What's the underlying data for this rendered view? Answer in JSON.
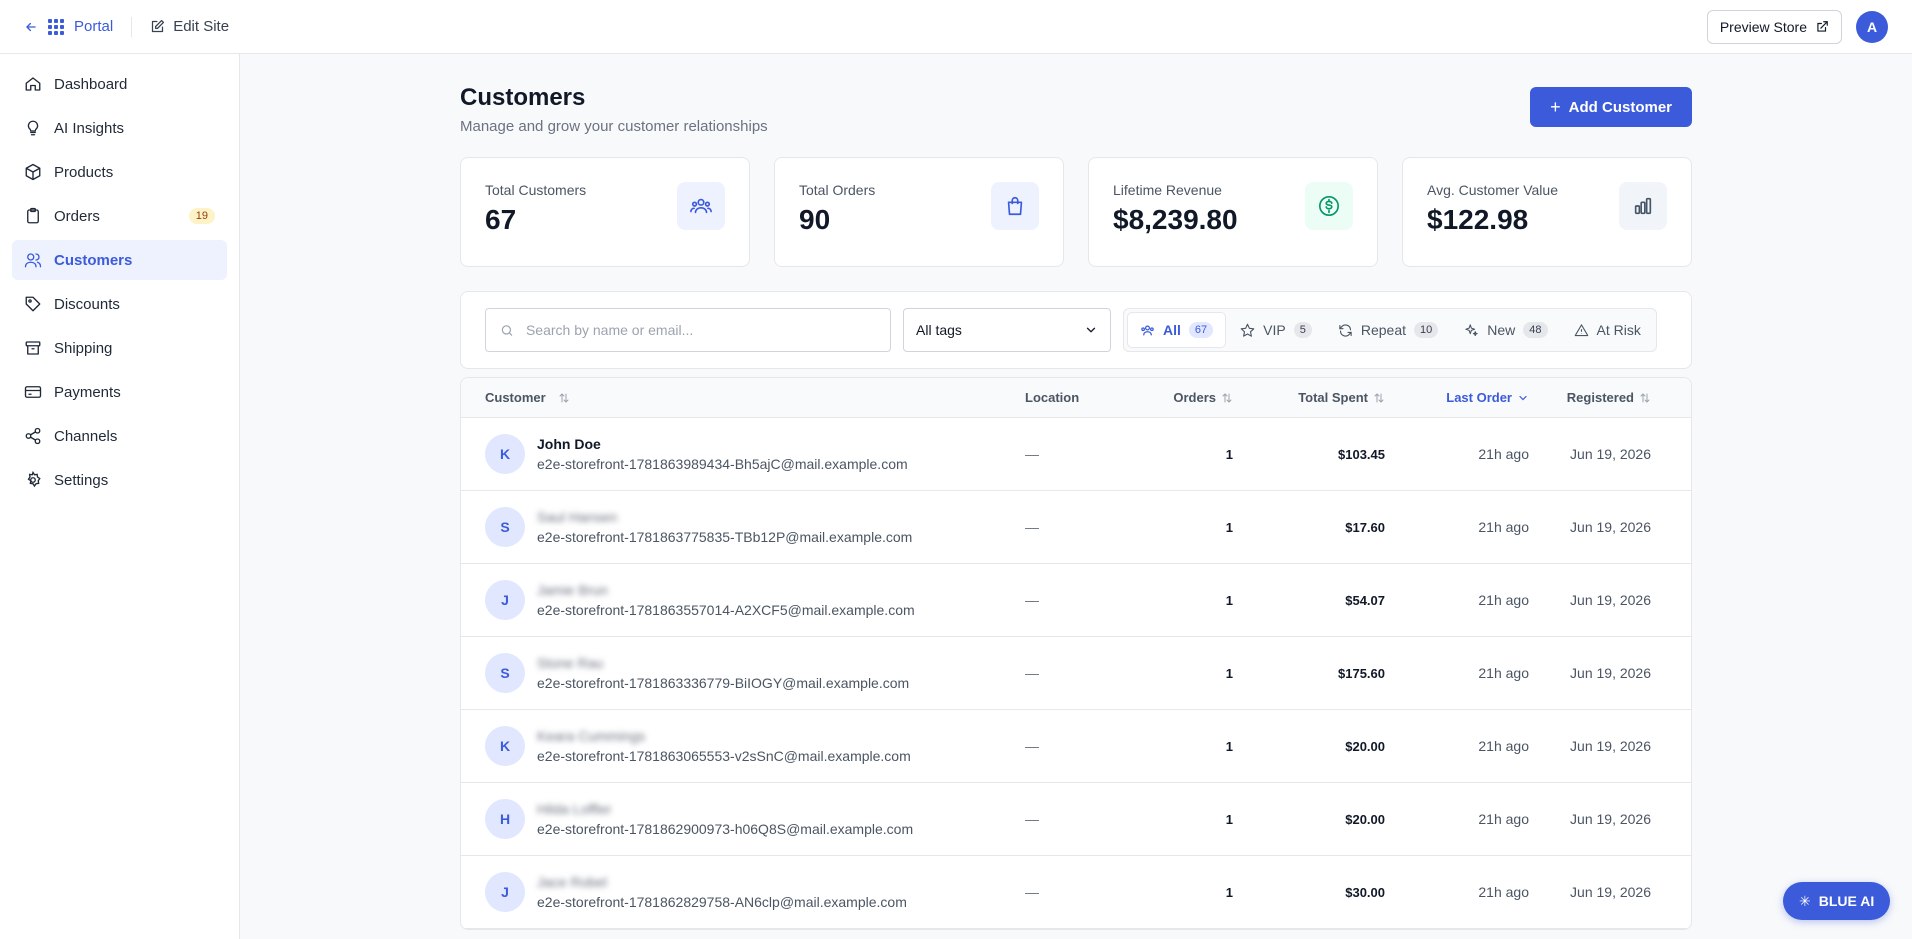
{
  "topbar": {
    "portal_label": "Portal",
    "edit_site_label": "Edit Site",
    "preview_label": "Preview Store",
    "avatar_letter": "A"
  },
  "sidebar": {
    "items": [
      {
        "label": "Dashboard",
        "icon": "home-icon"
      },
      {
        "label": "AI Insights",
        "icon": "lightbulb-icon"
      },
      {
        "label": "Products",
        "icon": "box-icon"
      },
      {
        "label": "Orders",
        "icon": "clipboard-icon",
        "badge": "19"
      },
      {
        "label": "Customers",
        "icon": "users-icon",
        "active": true
      },
      {
        "label": "Discounts",
        "icon": "tag-icon"
      },
      {
        "label": "Shipping",
        "icon": "archive-icon"
      },
      {
        "label": "Payments",
        "icon": "credit-card-icon"
      },
      {
        "label": "Channels",
        "icon": "share-icon"
      },
      {
        "label": "Settings",
        "icon": "gear-icon"
      }
    ]
  },
  "header": {
    "title": "Customers",
    "subtitle": "Manage and grow your customer relationships",
    "add_label": "Add Customer"
  },
  "stats": [
    {
      "label": "Total Customers",
      "value": "67",
      "icon": "users-icon",
      "color": "#3b5bdb",
      "bg": "#eef2ff"
    },
    {
      "label": "Total Orders",
      "value": "90",
      "icon": "shopping-bag-icon",
      "color": "#3b5bdb",
      "bg": "#eef2ff"
    },
    {
      "label": "Lifetime Revenue",
      "value": "$8,239.80",
      "icon": "dollar-icon",
      "color": "#059669",
      "bg": "#ecfdf5"
    },
    {
      "label": "Avg. Customer Value",
      "value": "$122.98",
      "icon": "bar-chart-icon",
      "color": "#475569",
      "bg": "#f1f5f9"
    }
  ],
  "filters": {
    "search_placeholder": "Search by name or email...",
    "tags_value": "All tags",
    "segments": [
      {
        "label": "All",
        "count": "67",
        "icon": "users-icon",
        "active": true
      },
      {
        "label": "VIP",
        "count": "5",
        "icon": "star-icon"
      },
      {
        "label": "Repeat",
        "count": "10",
        "icon": "refresh-icon"
      },
      {
        "label": "New",
        "count": "48",
        "icon": "sparkle-icon"
      },
      {
        "label": "At Risk",
        "icon": "warning-icon"
      }
    ]
  },
  "table": {
    "columns": {
      "customer": "Customer",
      "location": "Location",
      "orders": "Orders",
      "total_spent": "Total Spent",
      "last_order": "Last Order",
      "registered": "Registered"
    },
    "rows": [
      {
        "initial": "K",
        "name": "John Doe",
        "email": "e2e-storefront-1781863989434-Bh5ajC@mail.example.com",
        "location": "—",
        "orders": "1",
        "spent": "$103.45",
        "last": "21h ago",
        "registered": "Jun 19, 2026",
        "blurred": false
      },
      {
        "initial": "S",
        "name": "Saul Hansen",
        "email": "e2e-storefront-1781863775835-TBb12P@mail.example.com",
        "location": "—",
        "orders": "1",
        "spent": "$17.60",
        "last": "21h ago",
        "registered": "Jun 19, 2026",
        "blurred": true
      },
      {
        "initial": "J",
        "name": "Jamie Brun",
        "email": "e2e-storefront-1781863557014-A2XCF5@mail.example.com",
        "location": "—",
        "orders": "1",
        "spent": "$54.07",
        "last": "21h ago",
        "registered": "Jun 19, 2026",
        "blurred": true
      },
      {
        "initial": "S",
        "name": "Stone Rau",
        "email": "e2e-storefront-1781863336779-BiIOGY@mail.example.com",
        "location": "—",
        "orders": "1",
        "spent": "$175.60",
        "last": "21h ago",
        "registered": "Jun 19, 2026",
        "blurred": true
      },
      {
        "initial": "K",
        "name": "Keara Cummings",
        "email": "e2e-storefront-1781863065553-v2sSnC@mail.example.com",
        "location": "—",
        "orders": "1",
        "spent": "$20.00",
        "last": "21h ago",
        "registered": "Jun 19, 2026",
        "blurred": true
      },
      {
        "initial": "H",
        "name": "Hilda Loffler",
        "email": "e2e-storefront-1781862900973-h06Q8S@mail.example.com",
        "location": "—",
        "orders": "1",
        "spent": "$20.00",
        "last": "21h ago",
        "registered": "Jun 19, 2026",
        "blurred": true
      },
      {
        "initial": "J",
        "name": "Jace Robel",
        "email": "e2e-storefront-1781862829758-AN6clp@mail.example.com",
        "location": "—",
        "orders": "1",
        "spent": "$30.00",
        "last": "21h ago",
        "registered": "Jun 19, 2026",
        "blurred": true
      }
    ]
  },
  "assistant": {
    "label": "BLUE AI"
  }
}
